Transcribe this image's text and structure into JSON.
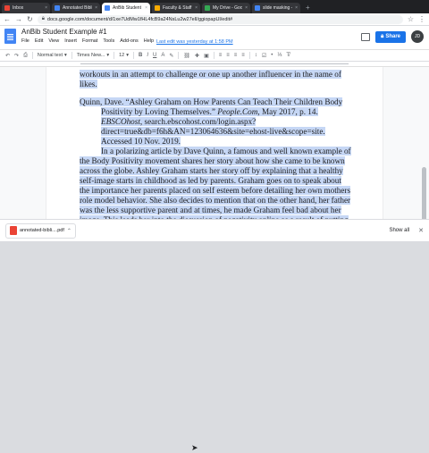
{
  "browser": {
    "tabs": [
      {
        "label": "Inbox",
        "color": "#ea4335"
      },
      {
        "label": "Annotated Bibliogr...",
        "color": "#4285f4"
      },
      {
        "label": "AnBib Student Exam...",
        "color": "#4285f4"
      },
      {
        "label": "Faculty & Staff Reso...",
        "color": "#f9ab00"
      },
      {
        "label": "My Drive - Google D...",
        "color": "#34a853"
      },
      {
        "label": "slide masking - Go...",
        "color": "#4285f4"
      }
    ],
    "url": "docs.google.com/document/d/1xe7UdMw1fHL4fcB9a24NsLu2w27elI/ggiopapUl/edit#"
  },
  "doc": {
    "title": "AnBib Student Example #1",
    "menu": [
      "File",
      "Edit",
      "View",
      "Insert",
      "Format",
      "Tools",
      "Add-ons",
      "Help"
    ],
    "last_edit": "Last edit was yesterday at 1:58 PM",
    "share_label": "Share",
    "avatar_initials": "JD"
  },
  "toolbar": {
    "style": "Normal text",
    "font": "Times New...",
    "size": "12"
  },
  "content": {
    "line0": "workouts in an attempt to challenge or one up another influencer in the name of likes.",
    "cite_pre": "Quinn, Dave. “Ashley Graham on How Parents Can Teach Their Children Body Positivity by Loving Themselves.” ",
    "cite_source": "People.Com",
    "cite_mid": ", May 2017, p. 14. ",
    "cite_db": "EBSCOhost",
    "cite_post": ", search.ebscohost.com/login.aspx?direct=true&db=f6h&AN=123064636&site=ehost-live&scope=site. Accessed 10 Nov. 2019.",
    "annotation": "In a polarizing article by Dave Quinn, a famous and well known example of the Body Positivity movement shares her story about how she came to be known across the globe. Ashley Graham starts her story off by explaining that a healthy self-image starts in childhood as led by parents. Graham goes on to speak about the importance her parents placed on self esteem before detailing her own mothers role model behavior. She also decides to mention that on the other hand, her father was the less supportive parent and at times, he made Graham feel bad about her image. This leads her into the discussion of negativity online as a result of putting her story out there for others to disagree to agree with. At this point in the article, it is clear that the criticism"
  },
  "downloads": {
    "file": "annotated-bibli....pdf",
    "show_all": "Show all"
  }
}
